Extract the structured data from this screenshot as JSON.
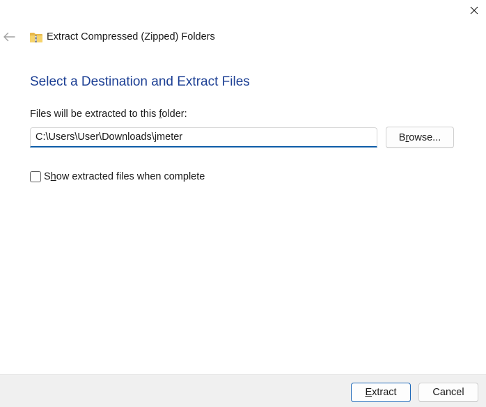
{
  "window": {
    "title": "Extract Compressed (Zipped) Folders",
    "close_icon": "close-icon",
    "back_icon": "back-arrow-icon",
    "app_icon": "zipped-folder-icon"
  },
  "main": {
    "heading": "Select a Destination and Extract Files",
    "destination_label_prefix": "Files will be extracted to this ",
    "destination_label_underlined": "f",
    "destination_label_suffix": "older:",
    "destination_path": "C:\\Users\\User\\Downloads\\jmeter",
    "browse_label_prefix": "B",
    "browse_label_underlined": "r",
    "browse_label_suffix": "owse...",
    "show_files_checked": false,
    "show_files_label_prefix": "S",
    "show_files_label_underlined": "h",
    "show_files_label_suffix": "ow extracted files when complete"
  },
  "footer": {
    "extract_label_underlined": "E",
    "extract_label_suffix": "xtract",
    "cancel_label": "Cancel"
  },
  "colors": {
    "heading": "#1c3f94",
    "accent": "#0e5ca8",
    "footer_bg": "#f0f0f0",
    "folder": "#f2c94c"
  }
}
